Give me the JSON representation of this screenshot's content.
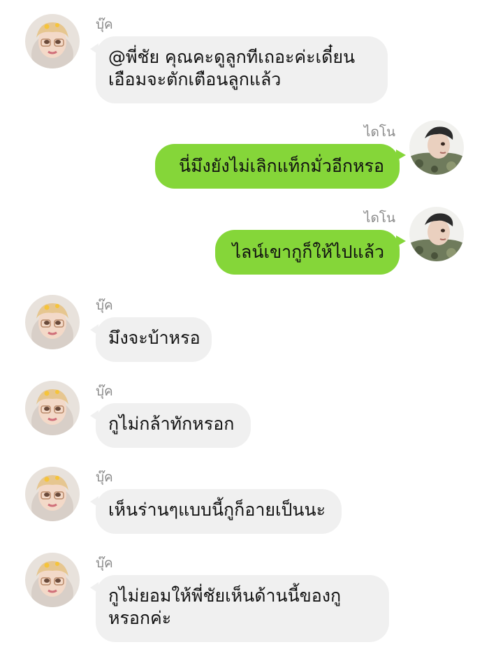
{
  "chat": {
    "messages": [
      {
        "sender": "บุ๊ค",
        "direction": "incoming",
        "lines": [
          "@พี่ชัย คุณคะดูลูกทีเถอะค่ะเดี๋ยน",
          "เอือมจะตักเตือนลูกแล้ว"
        ]
      },
      {
        "sender": "ไดโน",
        "direction": "outgoing",
        "lines": [
          "นี่มึงยังไม่เลิกแท็กมั่วอีกหรอ"
        ]
      },
      {
        "sender": "ไดโน",
        "direction": "outgoing",
        "lines": [
          "ไลน์เขากูก็ให้ไปแล้ว"
        ]
      },
      {
        "sender": "บุ๊ค",
        "direction": "incoming",
        "lines": [
          "มึงจะบ้าหรอ"
        ]
      },
      {
        "sender": "บุ๊ค",
        "direction": "incoming",
        "lines": [
          "กูไม่กล้าทักหรอก"
        ]
      },
      {
        "sender": "บุ๊ค",
        "direction": "incoming",
        "lines": [
          "เห็นร่านๆแบบนี้กูก็อายเป็นนะ"
        ]
      },
      {
        "sender": "บุ๊ค",
        "direction": "incoming",
        "lines": [
          "กูไม่ยอมให้พี่ชัยเห็นด้านนี้ของกู",
          "หรอกค่ะ"
        ]
      }
    ]
  },
  "colors": {
    "outgoing_bubble": "#85d639",
    "incoming_bubble": "#f0f0f0",
    "sender_name": "#8a8a8a",
    "background": "#ffffff"
  },
  "icons": {
    "incoming_avatar": "user-avatar-icon",
    "outgoing_avatar": "user-avatar-icon"
  }
}
